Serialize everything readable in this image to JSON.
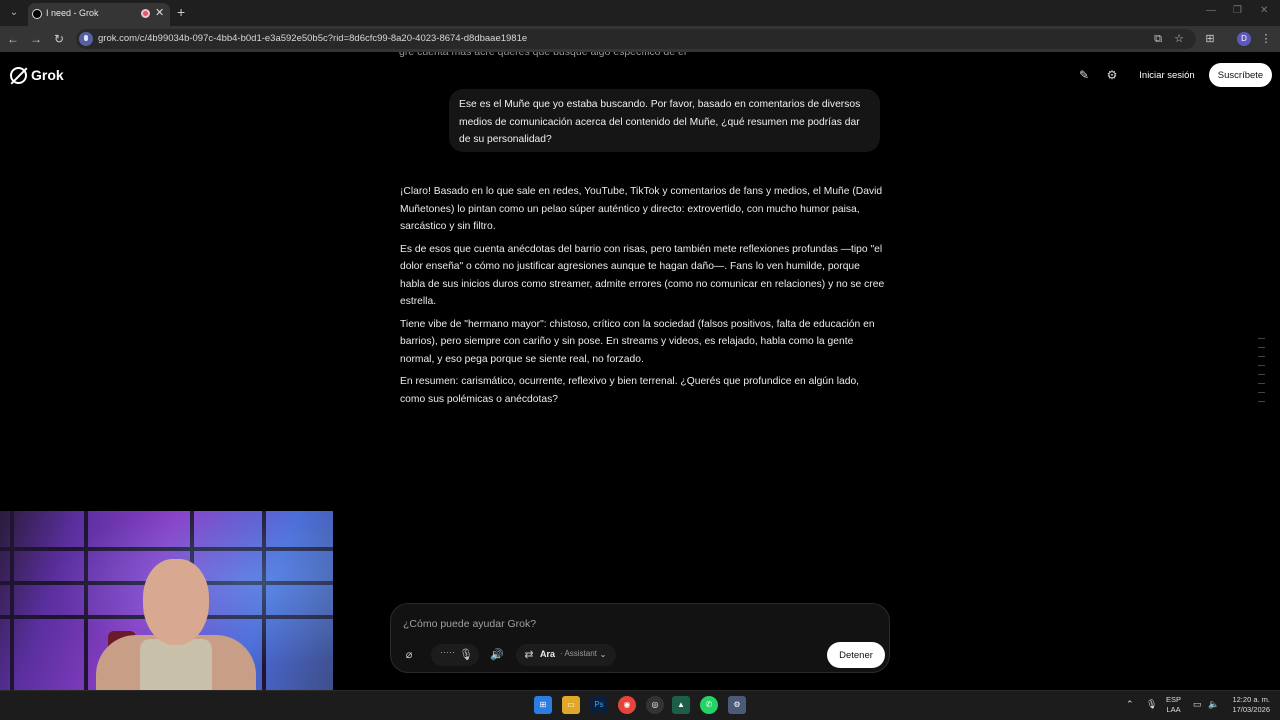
{
  "browser": {
    "tab_title": "I need - Grok",
    "url": "grok.com/c/4b99034b-097c-4bb4-b0d1-e3a592e50b5c?rid=8d6cfc99-8a20-4023-8674-d8dbaae1981e",
    "icons": [
      "tab-search-icon",
      "back-icon",
      "forward-icon",
      "reload-icon",
      "install-app-icon",
      "bookmark-star-icon",
      "extensions-icon",
      "profile-avatar",
      "menu-kebab-icon"
    ],
    "profile_initial": "D"
  },
  "header": {
    "logo_text": "Grok",
    "login_label": "Iniciar sesión",
    "subscribe_label": "Suscríbete"
  },
  "conversation": {
    "user_message": "Ese es el Muñe que yo estaba buscando. Por favor, basado en comentarios de diversos medios de comunicación acerca del contenido del Muñe, ¿qué resumen me podrías dar de su personalidad?",
    "answer_paragraphs": [
      "¡Claro! Basado en lo que sale en redes, YouTube, TikTok y comentarios de fans y medios, el Muñe (David Muñetones) lo pintan como un pelao súper auténtico y directo: extrovertido, con mucho humor paisa, sarcástico y sin filtro.",
      "Es de esos que cuenta anécdotas del barrio con risas, pero también mete reflexiones profundas —tipo \"el dolor enseña\" o cómo no justificar agresiones aunque te hagan daño—. Fans lo ven humilde, porque habla de sus inicios duros como streamer, admite errores (como no comunicar en relaciones) y no se cree estrella.",
      "Tiene vibe de \"hermano mayor\": chistoso, crítico con la sociedad (falsos positivos, falta de educación en barrios), pero siempre con cariño y sin pose. En streams y videos, es relajado, habla como la gente normal, y eso pega porque se siente real, no forzado.",
      "En resumen: carismático, ocurrente, reflexivo y bien terrenal. ¿Querés que profundice en algún lado, como sus polémicas o anécdotas?"
    ]
  },
  "composer": {
    "placeholder": "¿Cómo puede ayudar Grok?",
    "model_name": "Ara",
    "model_mode": "· Assistant",
    "stop_label": "Detener"
  },
  "taskbar": {
    "lang_1": "ESP",
    "lang_2": "LAA",
    "time": "12:20 a. m.",
    "date": "17/03/2026"
  }
}
